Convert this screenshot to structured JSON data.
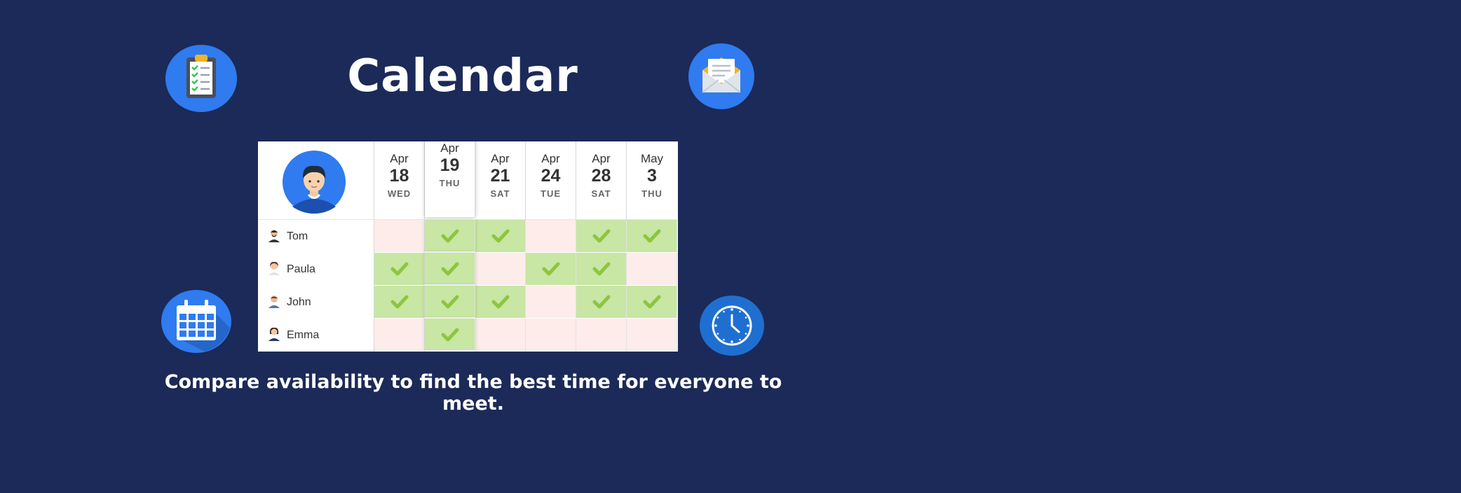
{
  "title": "Calendar",
  "tagline": "Compare availability to find the best time for everyone to meet.",
  "icons": {
    "top_left": "clipboard-icon",
    "top_right": "envelope-icon",
    "bottom_left": "calendar-icon",
    "bottom_right": "clock-icon",
    "user": "user-avatar-icon"
  },
  "colors": {
    "background": "#1b2a58",
    "available": "#c8e6a4",
    "unavailable": "#fdecea",
    "check": "#8dc63f",
    "icon_blue": "#2f7bef"
  },
  "columns": [
    {
      "month": "Apr",
      "day": "18",
      "weekday": "WED"
    },
    {
      "month": "Apr",
      "day": "19",
      "weekday": "THU"
    },
    {
      "month": "Apr",
      "day": "21",
      "weekday": "SAT"
    },
    {
      "month": "Apr",
      "day": "24",
      "weekday": "TUE"
    },
    {
      "month": "Apr",
      "day": "28",
      "weekday": "SAT"
    },
    {
      "month": "May",
      "day": "3",
      "weekday": "THU"
    }
  ],
  "rows": [
    {
      "name": "Tom",
      "availability": [
        false,
        true,
        true,
        false,
        true,
        true
      ]
    },
    {
      "name": "Paula",
      "availability": [
        true,
        true,
        false,
        true,
        true,
        false
      ]
    },
    {
      "name": "John",
      "availability": [
        true,
        true,
        true,
        false,
        true,
        true
      ]
    },
    {
      "name": "Emma",
      "availability": [
        false,
        true,
        false,
        false,
        false,
        false
      ]
    }
  ]
}
